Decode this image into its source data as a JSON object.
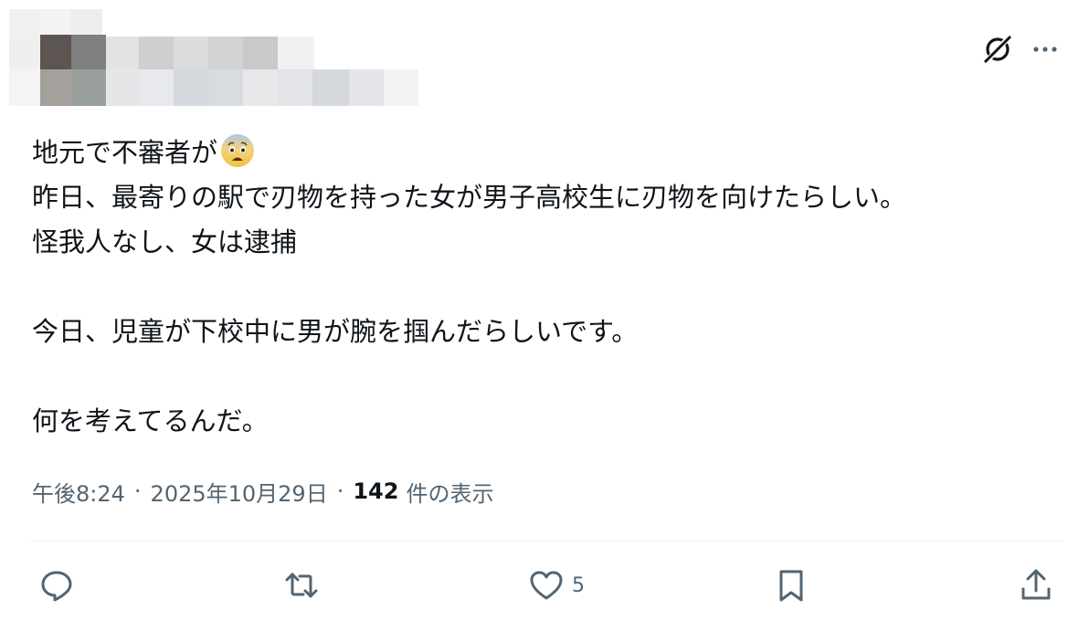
{
  "post": {
    "lines": [
      "地元で不審者が",
      "昨日、最寄りの駅で刃物を持った女が男子高校生に刃物を向けたらしい。",
      "怪我人なし、女は逮捕",
      "",
      "今日、児童が下校中に男が腕を掴んだらしいです。",
      "",
      "何を考えてるんだ。"
    ],
    "emoji": "fearful-face-emoji"
  },
  "meta": {
    "time": "午後8:24",
    "separator": "·",
    "date": "2025年10月29日",
    "views_count": "142",
    "views_label": "件の表示"
  },
  "actions": {
    "reply_icon": "reply-icon",
    "repost_icon": "repost-icon",
    "like_icon": "heart-icon",
    "like_count": "5",
    "bookmark_icon": "bookmark-icon",
    "share_icon": "share-icon"
  },
  "header": {
    "grok_icon": "grok-icon",
    "more_icon": "more-icon"
  },
  "colors": {
    "text": "#0f1419",
    "secondary": "#536471",
    "divider": "#eff3f4"
  }
}
